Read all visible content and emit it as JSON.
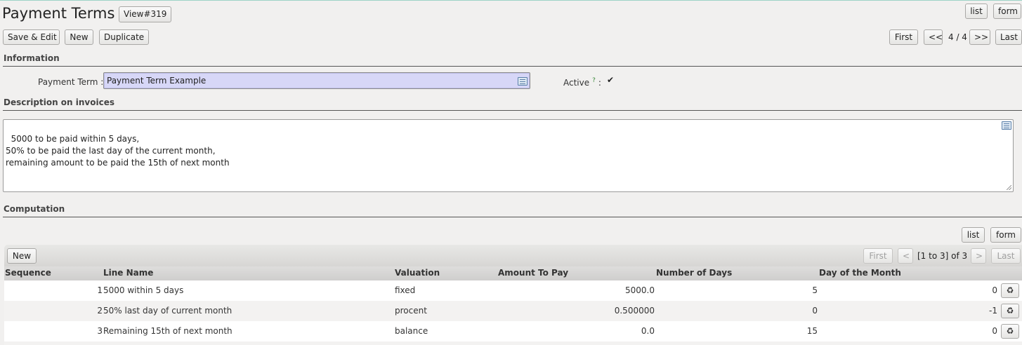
{
  "header": {
    "title": "Payment Terms",
    "view_id": "View#319",
    "view_list": "list",
    "view_form": "form"
  },
  "toolbar": {
    "save_edit": "Save & Edit",
    "new": "New",
    "duplicate": "Duplicate",
    "first": "First",
    "prev": "<<",
    "position": "4 / 4",
    "next": ">>",
    "last": "Last"
  },
  "information": {
    "section_title": "Information",
    "payment_term_label": "Payment Term :",
    "payment_term_value": "Payment Term Example",
    "active_label": "Active",
    "active_help": "?",
    "active_colon": ":",
    "active_checked": "✔"
  },
  "description": {
    "section_title": "Description on invoices",
    "text": "5000 to be paid within 5 days,\n50% to be paid the last day of the current month,\nremaining amount to be paid the 15th of next month"
  },
  "computation": {
    "section_title": "Computation",
    "view_list": "list",
    "view_form": "form",
    "new": "New",
    "first": "First",
    "prev": "<",
    "range": "[1 to 3] of 3",
    "next": ">",
    "last": "Last",
    "columns": [
      "Sequence",
      "Line Name",
      "Valuation",
      "Amount To Pay",
      "Number of Days",
      "Day of the Month"
    ],
    "rows": [
      {
        "sequence": "1",
        "name": "5000 within 5 days",
        "valuation": "fixed",
        "amount": "5000.0",
        "days": "5",
        "day_of_month": "0"
      },
      {
        "sequence": "2",
        "name": "50% last day of current month",
        "valuation": "procent",
        "amount": "0.500000",
        "days": "0",
        "day_of_month": "-1"
      },
      {
        "sequence": "3",
        "name": "Remaining 15th of next month",
        "valuation": "balance",
        "amount": "0.0",
        "days": "15",
        "day_of_month": "0"
      }
    ],
    "delete_icon": "♻"
  }
}
